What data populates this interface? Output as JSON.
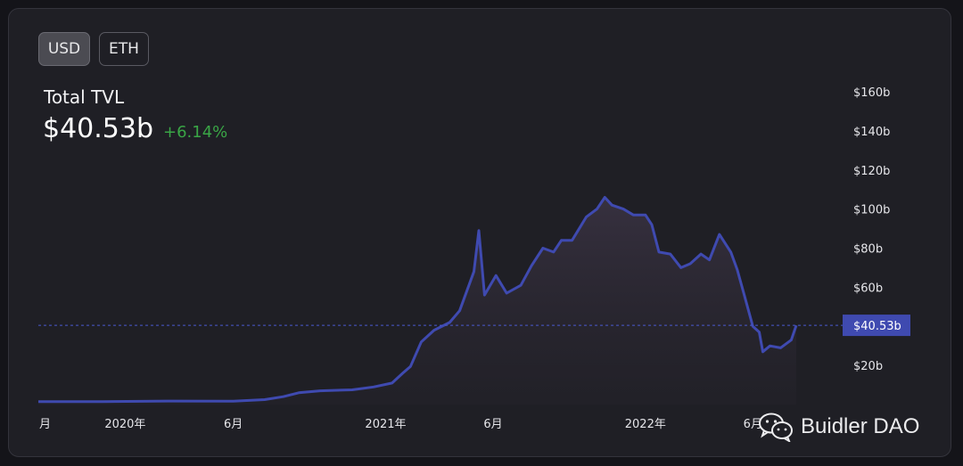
{
  "toggles": {
    "usd": "USD",
    "eth": "ETH"
  },
  "header": {
    "label": "Total TVL",
    "value": "$40.53b",
    "change": "+6.14%"
  },
  "watermark": "Buidler DAO",
  "colors": {
    "line": "#3f4ab0",
    "positive": "#3aa646",
    "badge": "#3f4ab0"
  },
  "chart_data": {
    "type": "area",
    "title": "",
    "xlabel": "",
    "ylabel": "",
    "ylim": [
      0,
      160
    ],
    "y_unit": "$b",
    "yticks": [
      "$160b",
      "$140b",
      "$120b",
      "$100b",
      "$80b",
      "$60b",
      "$20b"
    ],
    "yticks_values": [
      160,
      140,
      120,
      100,
      80,
      60,
      20
    ],
    "xticks": [
      "月",
      "2020年",
      "6月",
      "2021年",
      "6月",
      "2022年",
      "6月"
    ],
    "xticks_dates": [
      "2019-09-01",
      "2020-01-01",
      "2020-06-01",
      "2021-01-01",
      "2021-06-01",
      "2022-01-01",
      "2022-06-01"
    ],
    "current_value_label": "$40.53b",
    "current_value": 40.53,
    "grid": false,
    "series": [
      {
        "name": "",
        "x": [
          "2019-09-01",
          "2019-12-01",
          "2020-03-01",
          "2020-06-01",
          "2020-07-15",
          "2020-08-10",
          "2020-09-01",
          "2020-10-01",
          "2020-11-15",
          "2020-12-15",
          "2021-01-10",
          "2021-01-25",
          "2021-02-05",
          "2021-02-20",
          "2021-03-10",
          "2021-04-01",
          "2021-04-15",
          "2021-05-05",
          "2021-05-12",
          "2021-05-20",
          "2021-06-05",
          "2021-06-20",
          "2021-07-10",
          "2021-07-25",
          "2021-08-10",
          "2021-08-25",
          "2021-09-05",
          "2021-09-20",
          "2021-10-10",
          "2021-10-25",
          "2021-11-05",
          "2021-11-15",
          "2021-12-01",
          "2021-12-15",
          "2022-01-01",
          "2022-01-10",
          "2022-01-20",
          "2022-02-05",
          "2022-02-20",
          "2022-03-05",
          "2022-03-20",
          "2022-04-01",
          "2022-04-15",
          "2022-05-01",
          "2022-05-10",
          "2022-05-20",
          "2022-06-01",
          "2022-06-10",
          "2022-06-15",
          "2022-06-25",
          "2022-07-10",
          "2022-07-25",
          "2022-08-01"
        ],
        "values": [
          1.5,
          1.5,
          1.8,
          1.7,
          2.5,
          4,
          6,
          7,
          7.5,
          9,
          11,
          16,
          19.5,
          32,
          38,
          42,
          48,
          68,
          89,
          56,
          66,
          57,
          61,
          71,
          80,
          78,
          84,
          84,
          96,
          100,
          106,
          102,
          100,
          97,
          97,
          92,
          78,
          77,
          70,
          72,
          77,
          74,
          87,
          78,
          69,
          56,
          40,
          37,
          27,
          30,
          29,
          33,
          40.5
        ]
      }
    ]
  }
}
